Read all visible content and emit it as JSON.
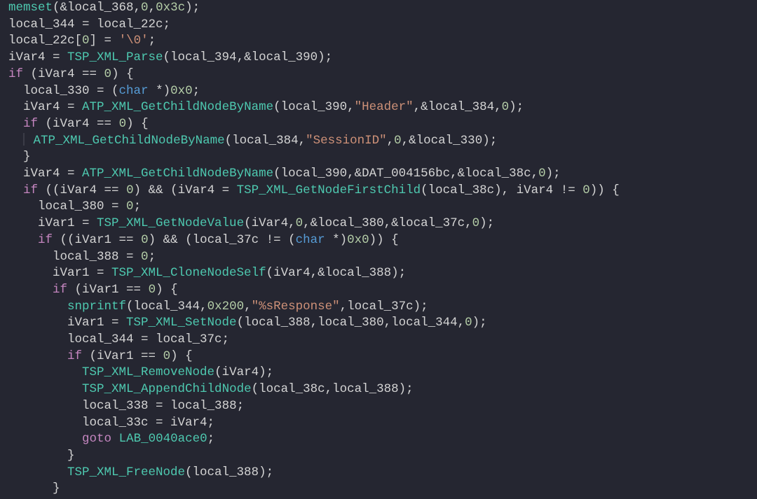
{
  "code": {
    "lines": [
      {
        "indent": 0,
        "tokens": [
          {
            "c": "t-fn",
            "t": "memset"
          },
          {
            "c": "t-op",
            "t": "(&local_368,"
          },
          {
            "c": "t-num",
            "t": "0"
          },
          {
            "c": "t-op",
            "t": ","
          },
          {
            "c": "t-num",
            "t": "0x3c"
          },
          {
            "c": "t-op",
            "t": ");"
          }
        ]
      },
      {
        "indent": 0,
        "tokens": [
          {
            "c": "t-id",
            "t": "local_344 = local_22c;"
          }
        ]
      },
      {
        "indent": 0,
        "tokens": [
          {
            "c": "t-id",
            "t": "local_22c["
          },
          {
            "c": "t-num",
            "t": "0"
          },
          {
            "c": "t-id",
            "t": "] = "
          },
          {
            "c": "t-str",
            "t": "'\\0'"
          },
          {
            "c": "t-id",
            "t": ";"
          }
        ]
      },
      {
        "indent": 0,
        "tokens": [
          {
            "c": "t-id",
            "t": "iVar4 = "
          },
          {
            "c": "t-fn",
            "t": "TSP_XML_Parse"
          },
          {
            "c": "t-id",
            "t": "(local_394,&local_390);"
          }
        ]
      },
      {
        "indent": 0,
        "tokens": [
          {
            "c": "t-kw",
            "t": "if"
          },
          {
            "c": "t-id",
            "t": " (iVar4 == "
          },
          {
            "c": "t-num",
            "t": "0"
          },
          {
            "c": "t-id",
            "t": ") {"
          }
        ]
      },
      {
        "indent": 1,
        "tokens": [
          {
            "c": "t-id",
            "t": "local_330 = ("
          },
          {
            "c": "t-ty",
            "t": "char"
          },
          {
            "c": "t-id",
            "t": " *)"
          },
          {
            "c": "t-num",
            "t": "0x0"
          },
          {
            "c": "t-id",
            "t": ";"
          }
        ]
      },
      {
        "indent": 1,
        "tokens": [
          {
            "c": "t-id",
            "t": "iVar4 = "
          },
          {
            "c": "t-fn",
            "t": "ATP_XML_GetChildNodeByName"
          },
          {
            "c": "t-id",
            "t": "(local_390,"
          },
          {
            "c": "t-str",
            "t": "\"Header\""
          },
          {
            "c": "t-id",
            "t": ",&local_384,"
          },
          {
            "c": "t-num",
            "t": "0"
          },
          {
            "c": "t-id",
            "t": ");"
          }
        ]
      },
      {
        "indent": 1,
        "tokens": [
          {
            "c": "t-kw",
            "t": "if"
          },
          {
            "c": "t-id",
            "t": " (iVar4 == "
          },
          {
            "c": "t-num",
            "t": "0"
          },
          {
            "c": "t-id",
            "t": ") {"
          }
        ]
      },
      {
        "indent": 2,
        "gut": true,
        "tokens": [
          {
            "c": "t-fn",
            "t": "ATP_XML_GetChildNodeByName"
          },
          {
            "c": "t-id",
            "t": "(local_384,"
          },
          {
            "c": "t-str",
            "t": "\"SessionID\""
          },
          {
            "c": "t-id",
            "t": ","
          },
          {
            "c": "t-num",
            "t": "0"
          },
          {
            "c": "t-id",
            "t": ",&local_330);"
          }
        ]
      },
      {
        "indent": 1,
        "tokens": [
          {
            "c": "t-id",
            "t": "}"
          }
        ]
      },
      {
        "indent": 1,
        "tokens": [
          {
            "c": "t-id",
            "t": "iVar4 = "
          },
          {
            "c": "t-fn",
            "t": "ATP_XML_GetChildNodeByName"
          },
          {
            "c": "t-id",
            "t": "(local_390,&DAT_004156bc,&local_38c,"
          },
          {
            "c": "t-num",
            "t": "0"
          },
          {
            "c": "t-id",
            "t": ");"
          }
        ]
      },
      {
        "indent": 1,
        "tokens": [
          {
            "c": "t-kw",
            "t": "if"
          },
          {
            "c": "t-id",
            "t": " ((iVar4 == "
          },
          {
            "c": "t-num",
            "t": "0"
          },
          {
            "c": "t-id",
            "t": ") && (iVar4 = "
          },
          {
            "c": "t-fn",
            "t": "TSP_XML_GetNodeFirstChild"
          },
          {
            "c": "t-id",
            "t": "(local_38c), iVar4 != "
          },
          {
            "c": "t-num",
            "t": "0"
          },
          {
            "c": "t-id",
            "t": ")) {"
          }
        ]
      },
      {
        "indent": 2,
        "tokens": [
          {
            "c": "t-id",
            "t": "local_380 = "
          },
          {
            "c": "t-num",
            "t": "0"
          },
          {
            "c": "t-id",
            "t": ";"
          }
        ]
      },
      {
        "indent": 2,
        "tokens": [
          {
            "c": "t-id",
            "t": "iVar1 = "
          },
          {
            "c": "t-fn",
            "t": "TSP_XML_GetNodeValue"
          },
          {
            "c": "t-id",
            "t": "(iVar4,"
          },
          {
            "c": "t-num",
            "t": "0"
          },
          {
            "c": "t-id",
            "t": ",&local_380,&local_37c,"
          },
          {
            "c": "t-num",
            "t": "0"
          },
          {
            "c": "t-id",
            "t": ");"
          }
        ]
      },
      {
        "indent": 2,
        "tokens": [
          {
            "c": "t-kw",
            "t": "if"
          },
          {
            "c": "t-id",
            "t": " ((iVar1 == "
          },
          {
            "c": "t-num",
            "t": "0"
          },
          {
            "c": "t-id",
            "t": ") && (local_37c != ("
          },
          {
            "c": "t-ty",
            "t": "char"
          },
          {
            "c": "t-id",
            "t": " *)"
          },
          {
            "c": "t-num",
            "t": "0x0"
          },
          {
            "c": "t-id",
            "t": ")) {"
          }
        ]
      },
      {
        "indent": 3,
        "tokens": [
          {
            "c": "t-id",
            "t": "local_388 = "
          },
          {
            "c": "t-num",
            "t": "0"
          },
          {
            "c": "t-id",
            "t": ";"
          }
        ]
      },
      {
        "indent": 3,
        "tokens": [
          {
            "c": "t-id",
            "t": "iVar1 = "
          },
          {
            "c": "t-fn",
            "t": "TSP_XML_CloneNodeSelf"
          },
          {
            "c": "t-id",
            "t": "(iVar4,&local_388);"
          }
        ]
      },
      {
        "indent": 3,
        "tokens": [
          {
            "c": "t-kw",
            "t": "if"
          },
          {
            "c": "t-id",
            "t": " (iVar1 == "
          },
          {
            "c": "t-num",
            "t": "0"
          },
          {
            "c": "t-id",
            "t": ") {"
          }
        ]
      },
      {
        "indent": 4,
        "tokens": [
          {
            "c": "t-fn",
            "t": "snprintf"
          },
          {
            "c": "t-id",
            "t": "(local_344,"
          },
          {
            "c": "t-num",
            "t": "0x200"
          },
          {
            "c": "t-id",
            "t": ","
          },
          {
            "c": "t-str",
            "t": "\"%sResponse\""
          },
          {
            "c": "t-id",
            "t": ",local_37c);"
          }
        ]
      },
      {
        "indent": 4,
        "tokens": [
          {
            "c": "t-id",
            "t": "iVar1 = "
          },
          {
            "c": "t-fn",
            "t": "TSP_XML_SetNode"
          },
          {
            "c": "t-id",
            "t": "(local_388,local_380,local_344,"
          },
          {
            "c": "t-num",
            "t": "0"
          },
          {
            "c": "t-id",
            "t": ");"
          }
        ]
      },
      {
        "indent": 4,
        "tokens": [
          {
            "c": "t-id",
            "t": "local_344 = local_37c;"
          }
        ]
      },
      {
        "indent": 4,
        "tokens": [
          {
            "c": "t-kw",
            "t": "if"
          },
          {
            "c": "t-id",
            "t": " (iVar1 == "
          },
          {
            "c": "t-num",
            "t": "0"
          },
          {
            "c": "t-id",
            "t": ") {"
          }
        ]
      },
      {
        "indent": 5,
        "tokens": [
          {
            "c": "t-fn",
            "t": "TSP_XML_RemoveNode"
          },
          {
            "c": "t-id",
            "t": "(iVar4);"
          }
        ]
      },
      {
        "indent": 5,
        "tokens": [
          {
            "c": "t-fn",
            "t": "TSP_XML_AppendChildNode"
          },
          {
            "c": "t-id",
            "t": "(local_38c,local_388);"
          }
        ]
      },
      {
        "indent": 5,
        "tokens": [
          {
            "c": "t-id",
            "t": "local_338 = local_388;"
          }
        ]
      },
      {
        "indent": 5,
        "tokens": [
          {
            "c": "t-id",
            "t": "local_33c = iVar4;"
          }
        ]
      },
      {
        "indent": 5,
        "tokens": [
          {
            "c": "t-kw",
            "t": "goto"
          },
          {
            "c": "t-id",
            "t": " "
          },
          {
            "c": "t-fn",
            "t": "LAB_0040ace0"
          },
          {
            "c": "t-id",
            "t": ";"
          }
        ]
      },
      {
        "indent": 4,
        "tokens": [
          {
            "c": "t-id",
            "t": "}"
          }
        ]
      },
      {
        "indent": 4,
        "tokens": [
          {
            "c": "t-fn",
            "t": "TSP_XML_FreeNode"
          },
          {
            "c": "t-id",
            "t": "(local_388);"
          }
        ]
      },
      {
        "indent": 3,
        "tokens": [
          {
            "c": "t-id",
            "t": "}"
          }
        ]
      }
    ]
  }
}
